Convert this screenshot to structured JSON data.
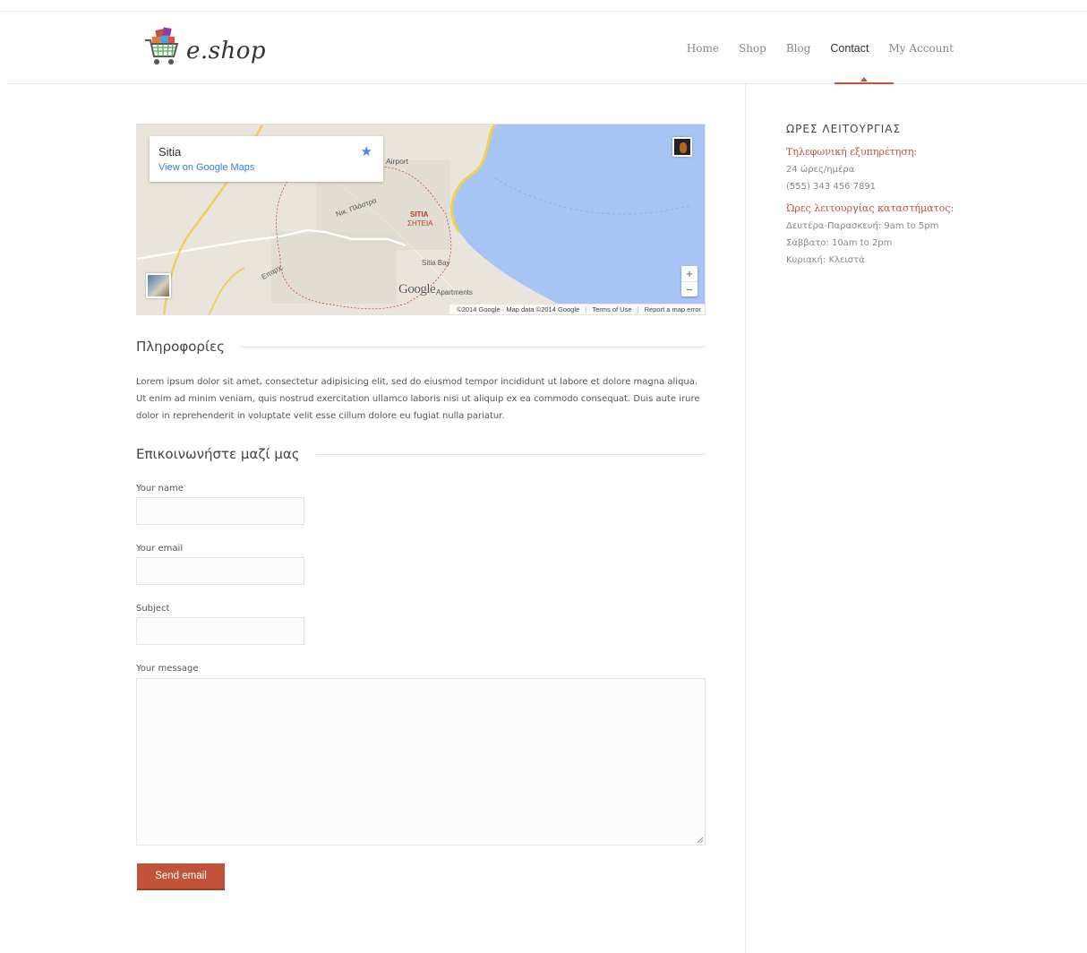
{
  "brand": {
    "logo_text": "e.shop",
    "accent": "#c0533a"
  },
  "nav": {
    "items": [
      {
        "label": "Home"
      },
      {
        "label": "Shop"
      },
      {
        "label": "Blog"
      },
      {
        "label": "Contact",
        "active": true
      },
      {
        "label": "My Account"
      }
    ]
  },
  "map": {
    "place": "Sitia",
    "link": "View on Google Maps",
    "labels": {
      "airport": "Airport",
      "city_latin": "SITIA",
      "city_greek": "ΣΗΤΕΙΑ",
      "bay": "Sitia Bay",
      "apartments": "Apartments",
      "street": "Νικ. Πλάστρα",
      "road": "Επαρχ.",
      "google": "Google"
    },
    "footer": {
      "data": "©2014 Google · Map data ©2014 Google",
      "terms": "Terms of Use",
      "report": "Report a map error"
    },
    "zoom_in": "+",
    "zoom_out": "−"
  },
  "info": {
    "heading": "Πληροφορίες",
    "body": "Lorem ipsum dolor sit amet, consectetur adipisicing elit, sed do eiusmod tempor incididunt ut labore et dolore magna aliqua. Ut enim ad minim veniam, quis nostrud exercitation ullamco laboris nisi ut aliquip ex ea commodo consequat. Duis aute irure dolor in reprehenderit in voluptate velit esse cillum dolore eu fugiat nulla pariatur."
  },
  "contact_form": {
    "heading": "Επικοινωνήστε μαζί μας",
    "name_label": "Your name",
    "name_value": "",
    "email_label": "Your email",
    "email_value": "",
    "subject_label": "Subject",
    "subject_value": "",
    "message_label": "Your message",
    "message_value": "",
    "submit_label": "Send email"
  },
  "sidebar": {
    "title": "ΩΡΕΣ ΛΕΙΤΟΥΡΓΙΑΣ",
    "phone_support": {
      "heading": "Τηλεφωνική εξυπηρέτηση:",
      "lines": [
        "24 ώρες/ημέρα",
        "(555) 343 456 7891"
      ]
    },
    "store_hours": {
      "heading": "Ώρες λειτουργίας καταστήματος:",
      "lines": [
        "Δευτέρα-Παρασκευή: 9am to 5pm",
        "Σάββατο: 10am to 2pm",
        "Κυριακή: Κλειστά"
      ]
    }
  }
}
